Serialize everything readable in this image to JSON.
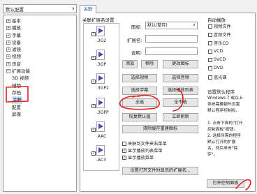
{
  "profile": {
    "value": "默认配置"
  },
  "tree": [
    {
      "label": "基本",
      "expander": "+",
      "child": false,
      "selected": false
    },
    {
      "label": "播放",
      "expander": "+",
      "child": false,
      "selected": false
    },
    {
      "label": "字幕",
      "expander": "+",
      "child": false,
      "selected": false
    },
    {
      "label": "设备",
      "expander": "+",
      "child": false,
      "selected": false
    },
    {
      "label": "滤镜",
      "expander": "+",
      "child": false,
      "selected": false
    },
    {
      "label": "视频",
      "expander": "+",
      "child": false,
      "selected": false
    },
    {
      "label": "声音",
      "expander": "+",
      "child": false,
      "selected": false
    },
    {
      "label": "扩展功能",
      "expander": "−",
      "child": false,
      "selected": false
    },
    {
      "label": "3D 视频",
      "expander": "",
      "child": true,
      "selected": false
    },
    {
      "label": "辅助",
      "expander": "",
      "child": true,
      "selected": false
    },
    {
      "label": "存档",
      "expander": "",
      "child": true,
      "selected": false
    },
    {
      "label": "关联",
      "expander": "",
      "child": true,
      "selected": true
    },
    {
      "label": "配置",
      "expander": "",
      "child": true,
      "selected": false
    },
    {
      "label": "屏保",
      "expander": "",
      "child": true,
      "selected": false
    }
  ],
  "tab": {
    "label": "关联"
  },
  "assoc": {
    "title": "关联扩展名设置",
    "extensions": [
      {
        "name": ".3G2",
        "checked": true
      },
      {
        "name": ".3GP",
        "checked": true
      },
      {
        "name": ".3GP2",
        "checked": true
      },
      {
        "name": ".3GPP",
        "checked": true
      },
      {
        "name": ".AAC",
        "checked": true
      },
      {
        "name": ".AC3",
        "checked": true
      }
    ],
    "icon_label": "图标:",
    "icon_value": "默认(整存)",
    "ext_label": "扩展名:",
    "desc_label": "说明:"
  },
  "buttons": {
    "add": "添加",
    "remove": "移除",
    "change_icon": "更改图标",
    "select_video": "选择视频",
    "select_audio": "选择音频",
    "select_subtitle": "选择字幕",
    "select_playlist": "选择播放列表",
    "select_all": "全选",
    "select_none": "全不选",
    "restore_default": "恢复默认值",
    "refresh_now": "立即刷新",
    "clear_cache": "清除缓存重建图标",
    "set_ext_names": "设置打开文件时显示的扩展名...",
    "open_control_panel": "打开控制面板"
  },
  "options": [
    {
      "label": "关联到文件夹右菜单",
      "checked": false
    },
    {
      "label": "显示播放列表菜单",
      "checked": true
    },
    {
      "label": "显示播放菜单",
      "checked": true
    }
  ],
  "autoplay": {
    "title": "自动播放",
    "items": [
      {
        "label": "视频文件",
        "checked": false
      },
      {
        "label": "音频文件",
        "checked": false
      },
      {
        "label": "音乐CD",
        "checked": false
      },
      {
        "label": "VCD",
        "checked": false
      },
      {
        "label": "SVCD",
        "checked": false
      },
      {
        "label": "DVD",
        "checked": false
      },
      {
        "label": "蓝光碟",
        "checked": false
      }
    ]
  },
  "default_program": {
    "title": "设置默认程序",
    "note_lines": [
      "Windows 7 或以上",
      "系统需要额外设置",
      "默认程序控制权。",
      "",
      "1. 点击下面的\"打开",
      "控制面板\"按钮。",
      "2. 选择所需的程序",
      "默认打开的扩展",
      "名，然后单击\"保",
      "存\"。"
    ]
  }
}
